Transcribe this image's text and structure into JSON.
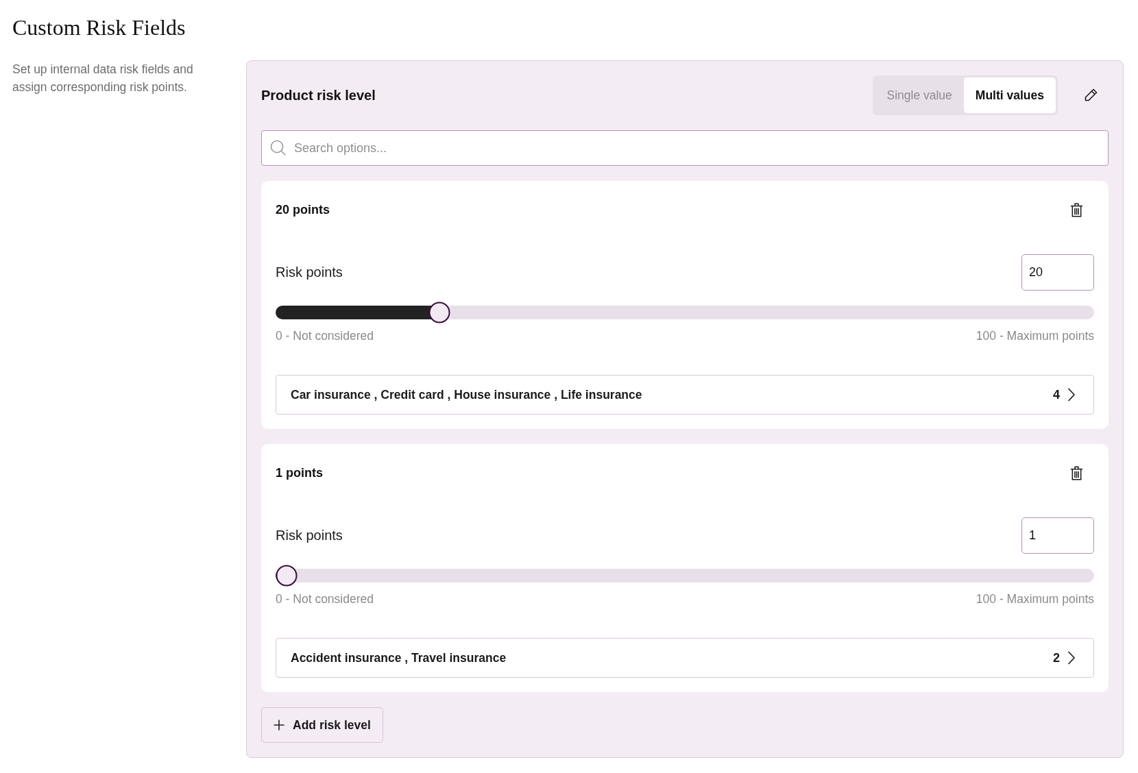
{
  "page": {
    "title": "Custom Risk Fields",
    "description": "Set up internal data risk fields and assign corresponding risk points."
  },
  "field": {
    "title": "Product risk level",
    "value_modes": [
      {
        "label": "Single value",
        "selected": false
      },
      {
        "label": "Multi values",
        "selected": true
      }
    ],
    "search": {
      "placeholder": "Search options..."
    },
    "risk_levels": [
      {
        "heading": "20 points",
        "points_label": "Risk points",
        "value": "20",
        "level": 0.2,
        "min_label": "0 - Not considered",
        "max_label": "100 - Maximum points",
        "options_summary": "Car insurance , Credit card , House insurance , Life insurance",
        "options_count": "4"
      },
      {
        "heading": "1 points",
        "points_label": "Risk points",
        "value": "1",
        "level": 0.01,
        "min_label": "0 - Not considered",
        "max_label": "100 - Maximum points",
        "options_summary": "Accident insurance , Travel insurance",
        "options_count": "2"
      }
    ],
    "add_button": "Add risk level"
  }
}
